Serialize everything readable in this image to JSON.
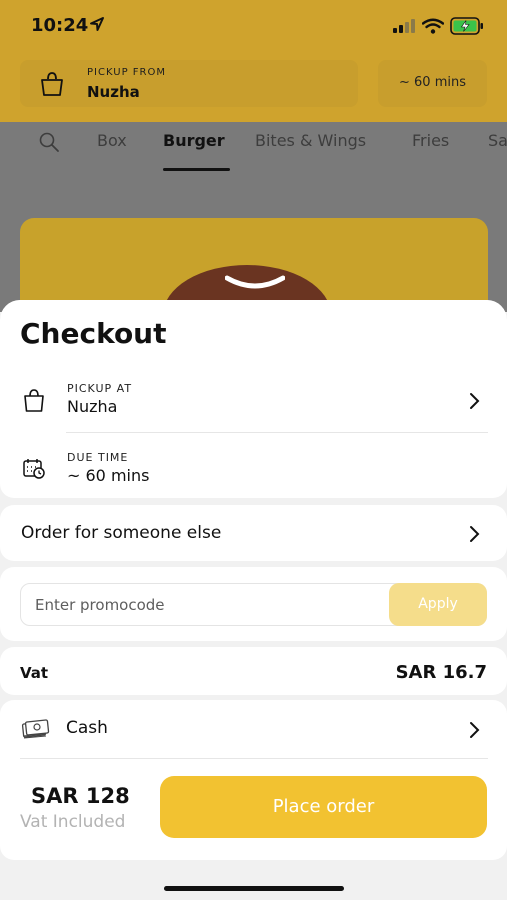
{
  "status_bar": {
    "time": "10:24"
  },
  "header": {
    "pickup_label": "PICKUP FROM",
    "pickup_location": "Nuzha",
    "eta": "~ 60 mins"
  },
  "category_tabs": {
    "items": [
      "Box",
      "Burger",
      "Bites & Wings",
      "Fries",
      "Sa"
    ],
    "active": "Burger"
  },
  "checkout": {
    "title": "Checkout",
    "pickup": {
      "label": "PICKUP AT",
      "value": "Nuzha"
    },
    "due_time": {
      "label": "DUE TIME",
      "value": "~ 60 mins"
    },
    "order_for_other": "Order for someone else",
    "promo": {
      "placeholder": "Enter promocode",
      "apply_label": "Apply"
    },
    "vat": {
      "label": "Vat",
      "value": "SAR 16.7"
    },
    "payment_method": "Cash",
    "total": {
      "price": "SAR 128",
      "note": "Vat Included"
    },
    "place_order_label": "Place order"
  },
  "colors": {
    "brand_yellow": "#f2c231",
    "header_overlay": "#cfa32d",
    "apply_disabled": "#f5dd8b"
  }
}
